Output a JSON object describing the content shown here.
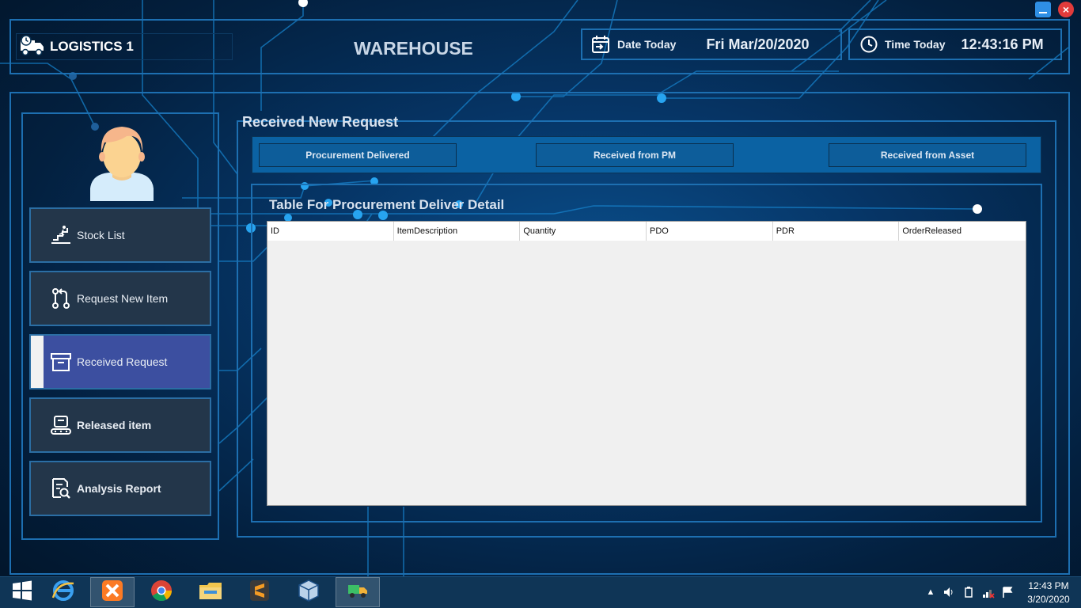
{
  "window": {
    "minimize_label": "",
    "close_label": "×"
  },
  "header": {
    "logo_text": "LOGISTICS 1",
    "title": "WAREHOUSE",
    "date_label": "Date Today",
    "date_value": "Fri Mar/20/2020",
    "time_label": "Time Today",
    "time_value": "12:43:16 PM"
  },
  "sidebar": {
    "items": [
      {
        "label": "Stock List",
        "icon": "stairs-climb-icon",
        "active": false,
        "bold": false
      },
      {
        "label": "Request New Item",
        "icon": "git-pull-request-icon",
        "active": false,
        "bold": false
      },
      {
        "label": "Received Request",
        "icon": "box-icon",
        "active": true,
        "bold": false
      },
      {
        "label": "Released item",
        "icon": "conveyor-icon",
        "active": false,
        "bold": true
      },
      {
        "label": "Analysis Report",
        "icon": "report-search-icon",
        "active": false,
        "bold": true
      }
    ]
  },
  "main": {
    "section_title": "Received New Request",
    "tabs": [
      {
        "label": "Procurement Delivered"
      },
      {
        "label": "Received from PM"
      },
      {
        "label": "Received from Asset"
      }
    ],
    "table_title": "Table For Procurement Deliver Detail",
    "table": {
      "columns": [
        "ID",
        "ItemDescription",
        "Quantity",
        "PDO",
        "PDR",
        "OrderReleased"
      ],
      "rows": []
    }
  },
  "taskbar": {
    "apps": [
      {
        "name": "windows-start-icon"
      },
      {
        "name": "internet-explorer-icon"
      },
      {
        "name": "xampp-icon"
      },
      {
        "name": "chrome-icon"
      },
      {
        "name": "file-explorer-icon"
      },
      {
        "name": "sublime-text-icon"
      },
      {
        "name": "virtualbox-icon"
      },
      {
        "name": "logistics-app-icon"
      }
    ],
    "clock_time": "12:43 PM",
    "clock_date": "3/20/2020"
  },
  "colors": {
    "accent_border": "#1d6fb1",
    "nav_bg": "#23364a",
    "nav_active_bg": "#3c4fa0",
    "tab_bg": "#0b62a3",
    "grid_bg": "#f0f0f0"
  }
}
